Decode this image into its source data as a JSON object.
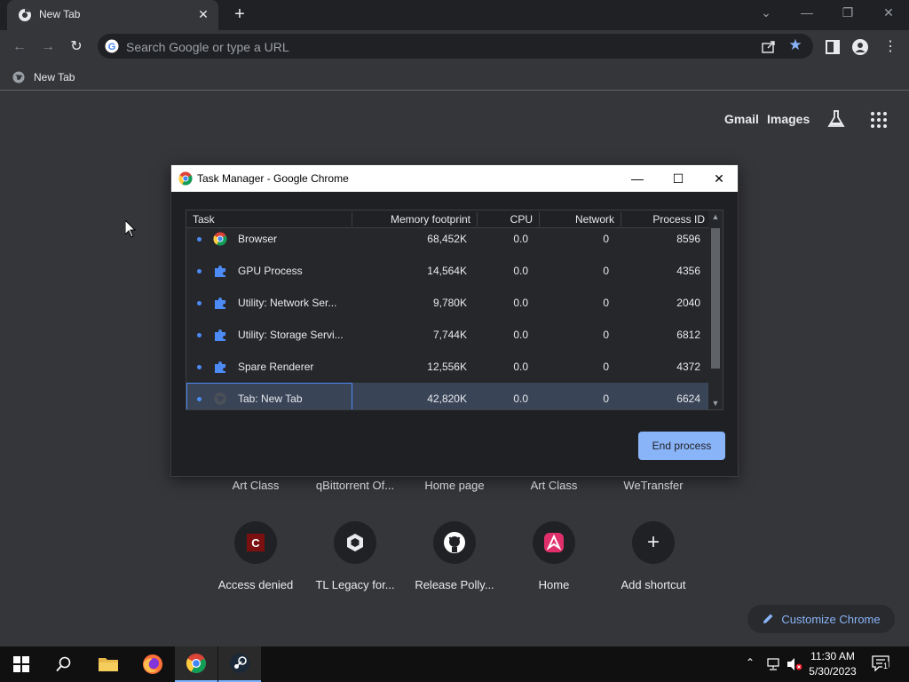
{
  "browser": {
    "tab_title": "New Tab",
    "omnibox_placeholder": "Search Google or type a URL",
    "bookmark_label": "New Tab"
  },
  "ntp": {
    "gmail": "Gmail",
    "images": "Images",
    "shortcuts_row1": [
      "Art Class",
      "qBittorrent Of...",
      "Home page",
      "Art Class",
      "WeTransfer"
    ],
    "shortcuts_row2": [
      "Access denied",
      "TL Legacy for...",
      "Release Polly...",
      "Home",
      "Add shortcut"
    ],
    "customize_label": "Customize Chrome"
  },
  "task_manager": {
    "title": "Task Manager - Google Chrome",
    "columns": [
      "Task",
      "Memory footprint",
      "CPU",
      "Network",
      "Process ID"
    ],
    "rows": [
      {
        "task": "Browser",
        "memory": "68,452K",
        "cpu": "0.0",
        "network": "0",
        "pid": "8596",
        "icon": "chrome-icon"
      },
      {
        "task": "GPU Process",
        "memory": "14,564K",
        "cpu": "0.0",
        "network": "0",
        "pid": "4356",
        "icon": "puzzle-icon"
      },
      {
        "task": "Utility: Network Ser...",
        "memory": "9,780K",
        "cpu": "0.0",
        "network": "0",
        "pid": "2040",
        "icon": "puzzle-icon"
      },
      {
        "task": "Utility: Storage Servi...",
        "memory": "7,744K",
        "cpu": "0.0",
        "network": "0",
        "pid": "6812",
        "icon": "puzzle-icon"
      },
      {
        "task": "Spare Renderer",
        "memory": "12,556K",
        "cpu": "0.0",
        "network": "0",
        "pid": "4372",
        "icon": "puzzle-icon"
      },
      {
        "task": "Tab: New Tab",
        "memory": "42,820K",
        "cpu": "0.0",
        "network": "0",
        "pid": "6624",
        "icon": "globe-icon",
        "selected": true
      }
    ],
    "end_process_label": "End process"
  },
  "taskbar": {
    "time": "11:30 AM",
    "date": "5/30/2023",
    "notification_count": "1"
  },
  "colors": {
    "accent": "#8ab4f8",
    "selection": "#394457",
    "dot": "#4c8bf5"
  }
}
